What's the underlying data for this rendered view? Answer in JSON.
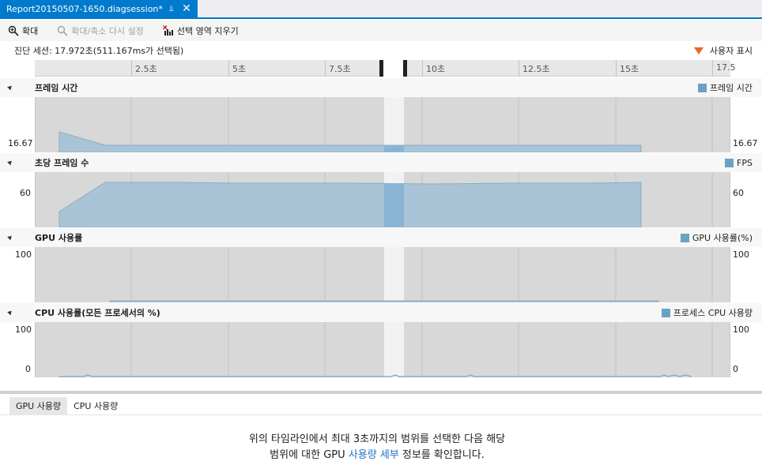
{
  "document_tab": {
    "title": "Report20150507-1650.diagsession*",
    "pin_icon": "pin-icon",
    "close_icon": "close-icon"
  },
  "toolbar": {
    "zoom_in_label": "확대",
    "reset_zoom_label": "확대/축소 다시 설정",
    "clear_selection_label": "선택 영역 지우기"
  },
  "session": {
    "info": "진단 세션: 17.972초(511.167ms가 선택됨)",
    "user_marks_label": "사용자 표시"
  },
  "ruler": {
    "ticks": [
      "2.5초",
      "5초",
      "7.5초",
      "10초",
      "12.5초",
      "15초",
      "17.5"
    ]
  },
  "sections": {
    "frame_time": {
      "title": "프레임 시간",
      "legend": "프레임 시간",
      "left_axis": "16.67",
      "right_axis": "16.67"
    },
    "fps": {
      "title": "초당 프레임 수",
      "legend": "FPS",
      "left_axis": "60",
      "right_axis": "60"
    },
    "gpu": {
      "title": "GPU 사용률",
      "legend": "GPU 사용률(%)",
      "left_axis_top": "100",
      "right_axis_top": "100"
    },
    "cpu": {
      "title": "CPU 사용률(모든 프로세서의 %)",
      "legend": "프로세스 CPU 사용량",
      "left_axis_top": "100",
      "left_axis_bottom": "0",
      "right_axis_top": "100",
      "right_axis_bottom": "0"
    }
  },
  "bottom_tabs": {
    "gpu": "GPU 사용량",
    "cpu": "CPU 사용량"
  },
  "message": {
    "line1": "위의 타임라인에서 최대 3초까지의 범위를 선택한 다음 해당",
    "line2_prefix": "범위에 대한 GPU ",
    "line2_link": "사용량 세부",
    "line2_suffix": " 정보를 확인합니다."
  },
  "colors": {
    "accent": "#007acc",
    "series_fill": "#6aa2c2",
    "user_mark": "#e8662a"
  }
}
